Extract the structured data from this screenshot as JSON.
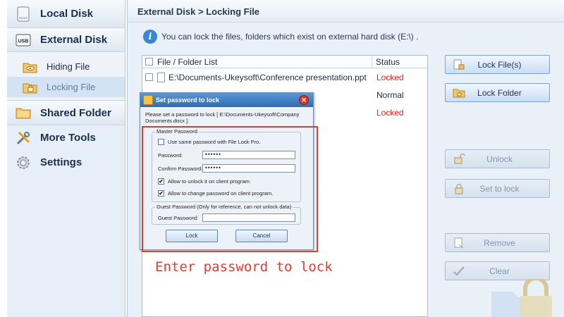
{
  "sidebar": {
    "local_disk": "Local Disk",
    "external_disk": "External Disk",
    "usb_badge": "USB",
    "sub_items": [
      "Hiding File",
      "Locking File"
    ],
    "shared_folder": "Shared Folder",
    "more_tools": "More Tools",
    "settings": "Settings",
    "icons": [
      "disk-icon",
      "usb-icon",
      "folder-eye-icon",
      "folder-lock-icon",
      "shared-folder-icon",
      "tools-icon",
      "gear-icon"
    ]
  },
  "header": {
    "breadcrumb": "External Disk > Locking File"
  },
  "info": {
    "icon_glyph": "i",
    "text": "You can lock the files, folders which exist on external hard disk (E:\\) ."
  },
  "file_list": {
    "columns": [
      "File / Folder List",
      "Status"
    ],
    "rows": [
      {
        "name": "E:\\Documents-Ukeysoft\\Conference presentation.ppt",
        "status": "Locked"
      },
      {
        "name": "",
        "status": "Normal"
      },
      {
        "name": "",
        "status": "Locked"
      }
    ]
  },
  "actions": {
    "lock_files": "Lock File(s)",
    "lock_folder": "Lock Folder",
    "unlock": "Unlock",
    "set_to_lock": "Set to lock",
    "remove": "Remove",
    "clear": "Clear"
  },
  "dialog": {
    "title": "Set password to lock",
    "close_glyph": "✕",
    "message": "Please set a password to lock [ E:\\Documents-Ukeysoft\\Company Documents.docx ].",
    "master_group": "Master Password",
    "same_password_label": "Use same password with File Lock Pro.",
    "password_label": "Password:",
    "password_value": "••••••",
    "confirm_label": "Confirm Password:",
    "confirm_value": "••••••",
    "allow_unlock_label": "Allow to unlock it on client program.",
    "allow_change_label": "Allow to change password on client program.",
    "check_glyph": "✔",
    "guest_group": "Guest Password (Only for reference, can not unlock data)",
    "guest_label": "Guest Password:",
    "guest_value": "",
    "lock_button": "Lock",
    "cancel_button": "Cancel"
  },
  "annotation": "Enter password to lock",
  "colors": {
    "locked": "#e8201a",
    "annotation": "#ea3a2f",
    "accent": "#3a86d0"
  }
}
